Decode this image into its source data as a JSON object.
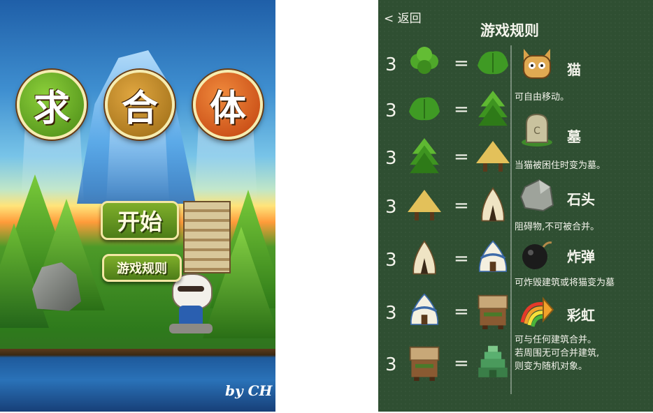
{
  "title_screen": {
    "title_chars": [
      "求",
      "合",
      "体"
    ],
    "start_label": "开始",
    "rules_label": "游戏规则",
    "credit": "by CH"
  },
  "rules_screen": {
    "back_label": "< 返回",
    "title": "游戏规则",
    "multiplier": "3",
    "equals": "=",
    "merge_rows": [
      {
        "from": "clover-bush-icon",
        "to": "leafy-bush-icon"
      },
      {
        "from": "leafy-bush-icon",
        "to": "pine-tree-icon"
      },
      {
        "from": "pine-tree-icon",
        "to": "straw-hut-icon"
      },
      {
        "from": "straw-hut-icon",
        "to": "tent-icon"
      },
      {
        "from": "tent-icon",
        "to": "yurt-icon"
      },
      {
        "from": "yurt-icon",
        "to": "wooden-house-icon"
      },
      {
        "from": "wooden-house-icon",
        "to": "green-pagoda-icon"
      }
    ],
    "legend": {
      "cat": {
        "name": "猫",
        "desc": "可自由移动。"
      },
      "tomb": {
        "name": "墓",
        "desc": "当猫被困住时变为墓。"
      },
      "stone": {
        "name": "石头",
        "desc": "阻碍物,不可被合并。"
      },
      "bomb": {
        "name": "炸弹",
        "desc": "可炸毁建筑或将猫变为墓"
      },
      "rainbow": {
        "name": "彩虹",
        "desc": [
          "可与任何建筑合并。",
          "若周围无可合并建筑,",
          "则变为随机对象。"
        ]
      }
    }
  },
  "colors": {
    "chalkboard": "#2f4f32",
    "title_green": "#5a9a1e",
    "title_brown": "#b07a1e",
    "title_red": "#d0501c",
    "button_green": "#6a9a22"
  }
}
